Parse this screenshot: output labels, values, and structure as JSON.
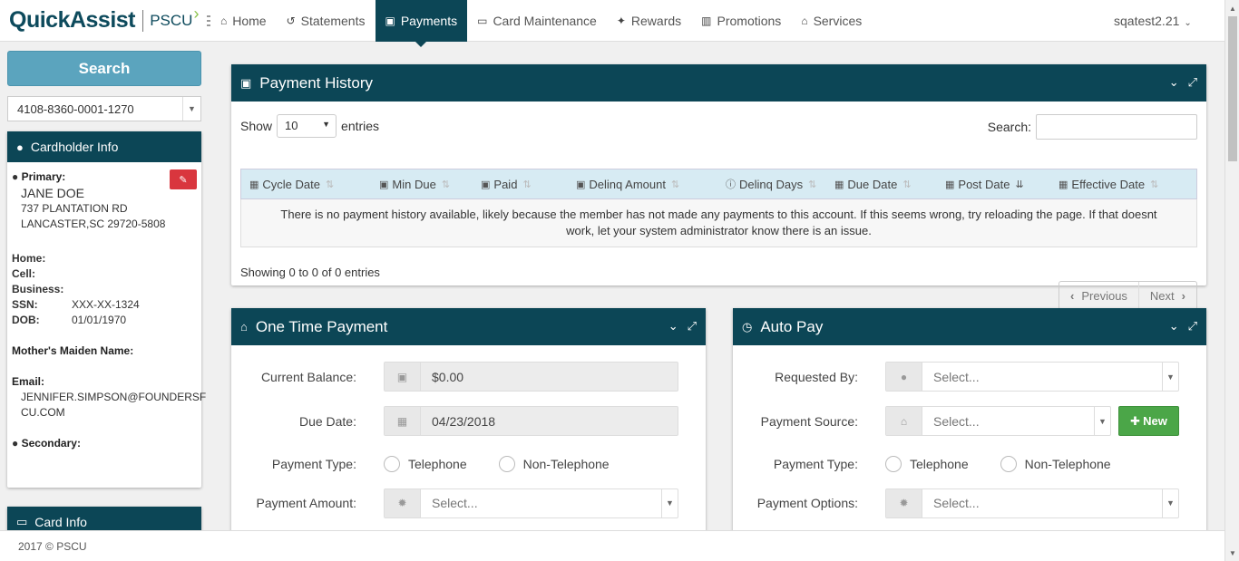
{
  "brand": {
    "name": "QuickAssist",
    "partner": "PSCU"
  },
  "nav": {
    "items": [
      {
        "label": "Home",
        "icon": "home-icon"
      },
      {
        "label": "Statements",
        "icon": "history-icon"
      },
      {
        "label": "Payments",
        "icon": "money-icon",
        "active": true
      },
      {
        "label": "Card Maintenance",
        "icon": "credit-card-icon"
      },
      {
        "label": "Rewards",
        "icon": "gift-icon"
      },
      {
        "label": "Promotions",
        "icon": "bar-chart-icon"
      },
      {
        "label": "Services",
        "icon": "bank-icon"
      }
    ],
    "user": "sqatest2.21"
  },
  "sidebar": {
    "search_label": "Search",
    "card_number": "4108-8360-0001-1270",
    "cardholder": {
      "title": "Cardholder Info",
      "primary_label": "Primary:",
      "name": "JANE DOE",
      "address1": "737 PLANTATION RD",
      "address2": "LANCASTER,SC 29720-5808",
      "home_label": "Home:",
      "cell_label": "Cell:",
      "business_label": "Business:",
      "ssn_label": "SSN:",
      "ssn": "XXX-XX-1324",
      "dob_label": "DOB:",
      "dob": "01/01/1970",
      "maiden_label": "Mother's Maiden Name:",
      "email_label": "Email:",
      "email_line1": "JENNIFER.SIMPSON@FOUNDERSF",
      "email_line2": "CU.COM",
      "secondary_label": "Secondary:"
    },
    "card_info_title": "Card Info"
  },
  "history": {
    "title": "Payment History",
    "show_label": "Show",
    "page_length": "10",
    "entries_label": "entries",
    "search_label": "Search:",
    "columns": [
      {
        "label": "Cycle Date",
        "icon": "calendar-icon"
      },
      {
        "label": "Min Due",
        "icon": "money-icon"
      },
      {
        "label": "Paid",
        "icon": "money-icon"
      },
      {
        "label": "Delinq Amount",
        "icon": "money-icon"
      },
      {
        "label": "Delinq Days",
        "icon": "info-icon"
      },
      {
        "label": "Due Date",
        "icon": "calendar-icon"
      },
      {
        "label": "Post Date",
        "icon": "calendar-icon"
      },
      {
        "label": "Effective Date",
        "icon": "calendar-icon"
      }
    ],
    "empty_line1": "There is no payment history available, likely because the member has not made any payments to this account. If this seems wrong, try reloading the page. If that doesnt",
    "empty_line2": "work, let your system administrator know there is an issue.",
    "info": "Showing 0 to 0 of 0 entries",
    "prev_label": "Previous",
    "next_label": "Next"
  },
  "one_time": {
    "title": "One Time Payment",
    "balance_label": "Current Balance:",
    "balance": "$0.00",
    "due_label": "Due Date:",
    "due": "04/23/2018",
    "type_label": "Payment Type:",
    "type_opt1": "Telephone",
    "type_opt2": "Non-Telephone",
    "amount_label": "Payment Amount:",
    "amount_placeholder": "Select..."
  },
  "auto_pay": {
    "title": "Auto Pay",
    "requested_label": "Requested By:",
    "requested_placeholder": "Select...",
    "source_label": "Payment Source:",
    "source_placeholder": "Select...",
    "new_label": "New",
    "type_label": "Payment Type:",
    "type_opt1": "Telephone",
    "type_opt2": "Non-Telephone",
    "options_label": "Payment Options:",
    "options_placeholder": "Select..."
  },
  "footer": {
    "copyright": "2017 © PSCU"
  }
}
